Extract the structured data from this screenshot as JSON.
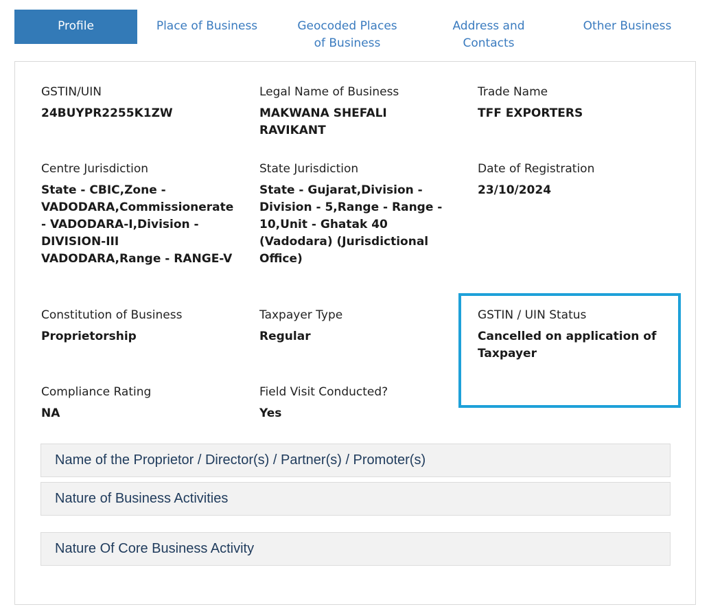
{
  "tabs": [
    {
      "label": "Profile",
      "active": true
    },
    {
      "label": "Place of Business"
    },
    {
      "label": "Geocoded Places of Business"
    },
    {
      "label": "Address and Contacts"
    },
    {
      "label": "Other Business"
    }
  ],
  "profile": {
    "gstin": {
      "label": "GSTIN/UIN",
      "value": "24BUYPR2255K1ZW"
    },
    "legal_name": {
      "label": "Legal Name of Business",
      "value": "MAKWANA SHEFALI RAVIKANT"
    },
    "trade_name": {
      "label": "Trade Name",
      "value": "TFF EXPORTERS"
    },
    "centre_jurisdiction": {
      "label": "Centre Jurisdiction",
      "value": "State - CBIC,Zone - VADODARA,Commissionerate - VADODARA-I,Division - DIVISION-III VADODARA,Range - RANGE-V"
    },
    "state_jurisdiction": {
      "label": "State Jurisdiction",
      "value": "State - Gujarat,Division - Division - 5,Range - Range - 10,Unit - Ghatak 40 (Vadodara) (Jurisdictional Office)"
    },
    "registration_date": {
      "label": "Date of Registration",
      "value": "23/10/2024"
    },
    "constitution": {
      "label": "Constitution of Business",
      "value": "Proprietorship"
    },
    "taxpayer_type": {
      "label": "Taxpayer Type",
      "value": "Regular"
    },
    "status": {
      "label": "GSTIN / UIN Status",
      "value": "Cancelled on application of Taxpayer"
    },
    "compliance_rating": {
      "label": "Compliance Rating",
      "value": "NA"
    },
    "field_visit": {
      "label": "Field Visit Conducted?",
      "value": "Yes"
    }
  },
  "accordions": [
    {
      "label": "Name of the Proprietor / Director(s) / Partner(s) / Promoter(s)"
    },
    {
      "label": "Nature of Business Activities"
    },
    {
      "label": "Nature Of Core Business Activity"
    }
  ],
  "colors": {
    "accent": "#337ab7",
    "highlight_border": "#1ea1d9",
    "link": "#3a7bbf"
  }
}
